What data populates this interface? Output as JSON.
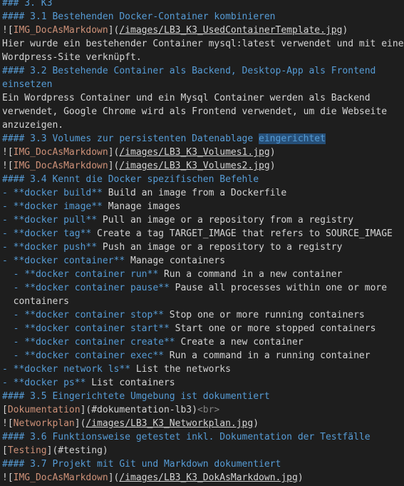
{
  "colors": {
    "background": "#1e1e1e",
    "text": "#d4d4d4",
    "heading": "#569cd6",
    "bracket": "#ce9178",
    "url": "#d4d4d4",
    "keyword": "#569cd6",
    "tag": "#808080",
    "selection": "#264f78"
  },
  "lines": [
    {
      "spans": [
        {
          "t": "### 3. K3",
          "c": "heading"
        }
      ]
    },
    {
      "spans": [
        {
          "t": "#### 3.1 Bestehenden Docker-Container kombinieren",
          "c": "heading"
        }
      ]
    },
    {
      "spans": [
        {
          "t": "![",
          "c": "text"
        },
        {
          "t": "IMG_DocAsMarkdown",
          "c": "bracket"
        },
        {
          "t": "](",
          "c": "text"
        },
        {
          "t": "/images/LB3_K3_UsedContainerTemplate.jpg",
          "c": "url",
          "u": true
        },
        {
          "t": ")",
          "c": "text"
        }
      ]
    },
    {
      "spans": [
        {
          "t": "Hier wurde ein bestehender Container mysql:latest verwendet und mit einer",
          "c": "text"
        }
      ]
    },
    {
      "spans": [
        {
          "t": "Wordpress-Site verknüpft.",
          "c": "text"
        }
      ]
    },
    {
      "spans": [
        {
          "t": "#### 3.2 Bestehende Container als Backend, Desktop-App als Frontend",
          "c": "heading"
        }
      ]
    },
    {
      "spans": [
        {
          "t": "einsetzen",
          "c": "heading"
        }
      ]
    },
    {
      "spans": [
        {
          "t": "Ein Wordpress Container und ein Mysql Container werden als Backend",
          "c": "text"
        }
      ]
    },
    {
      "spans": [
        {
          "t": "verwendet, Google Chrome wird als Frontend verwendet, um die Webseite",
          "c": "text"
        }
      ]
    },
    {
      "spans": [
        {
          "t": "anzuzeigen.",
          "c": "text"
        }
      ]
    },
    {
      "spans": [
        {
          "t": "#### 3.3 Volumes zur persistenten Datenablage ",
          "c": "heading"
        },
        {
          "t": "eingerichtet",
          "c": "heading",
          "h": true
        }
      ]
    },
    {
      "spans": [
        {
          "t": "![",
          "c": "text"
        },
        {
          "t": "IMG_DocAsMarkdown",
          "c": "bracket"
        },
        {
          "t": "](",
          "c": "text"
        },
        {
          "t": "/images/LB3_K3_Volumes1.jpg",
          "c": "url",
          "u": true
        },
        {
          "t": ")",
          "c": "text"
        }
      ]
    },
    {
      "spans": [
        {
          "t": "![",
          "c": "text"
        },
        {
          "t": "IMG_DocAsMarkdown",
          "c": "bracket"
        },
        {
          "t": "](",
          "c": "text"
        },
        {
          "t": "/images/LB3_K3_Volumes2.jpg",
          "c": "url",
          "u": true
        },
        {
          "t": ")",
          "c": "text"
        }
      ]
    },
    {
      "spans": [
        {
          "t": "#### 3.4 Kennt die Docker spezifischen Befehle",
          "c": "heading"
        }
      ]
    },
    {
      "spans": [
        {
          "t": "- ",
          "c": "keyword"
        },
        {
          "t": "**docker build**",
          "c": "keyword"
        },
        {
          "t": " Build an image from a Dockerfile",
          "c": "text"
        }
      ]
    },
    {
      "spans": [
        {
          "t": "- ",
          "c": "keyword"
        },
        {
          "t": "**docker image**",
          "c": "keyword"
        },
        {
          "t": " Manage images",
          "c": "text"
        }
      ]
    },
    {
      "spans": [
        {
          "t": "- ",
          "c": "keyword"
        },
        {
          "t": "**docker pull**",
          "c": "keyword"
        },
        {
          "t": " Pull an image or a repository from a registry",
          "c": "text"
        }
      ]
    },
    {
      "spans": [
        {
          "t": "- ",
          "c": "keyword"
        },
        {
          "t": "**docker tag**",
          "c": "keyword"
        },
        {
          "t": " Create a tag TARGET_IMAGE that refers to SOURCE_IMAGE",
          "c": "text"
        }
      ]
    },
    {
      "spans": [
        {
          "t": "- ",
          "c": "keyword"
        },
        {
          "t": "**docker push**",
          "c": "keyword"
        },
        {
          "t": " Push an image or a repository to a registry",
          "c": "text"
        }
      ]
    },
    {
      "spans": [
        {
          "t": "- ",
          "c": "keyword"
        },
        {
          "t": "**docker container**",
          "c": "keyword"
        },
        {
          "t": " Manage containers",
          "c": "text"
        }
      ]
    },
    {
      "spans": [
        {
          "t": "  - ",
          "c": "keyword"
        },
        {
          "t": "**docker container run**",
          "c": "keyword"
        },
        {
          "t": " Run a command in a new container",
          "c": "text"
        }
      ]
    },
    {
      "spans": [
        {
          "t": "  - ",
          "c": "keyword"
        },
        {
          "t": "**docker container pause**",
          "c": "keyword"
        },
        {
          "t": " Pause all processes within one or more",
          "c": "text"
        }
      ]
    },
    {
      "spans": [
        {
          "t": "  containers",
          "c": "text"
        }
      ]
    },
    {
      "spans": [
        {
          "t": "  - ",
          "c": "keyword"
        },
        {
          "t": "**docker container stop**",
          "c": "keyword"
        },
        {
          "t": " Stop one or more running containers",
          "c": "text"
        }
      ]
    },
    {
      "spans": [
        {
          "t": "  - ",
          "c": "keyword"
        },
        {
          "t": "**docker container start**",
          "c": "keyword"
        },
        {
          "t": " Start one or more stopped containers",
          "c": "text"
        }
      ]
    },
    {
      "spans": [
        {
          "t": "  - ",
          "c": "keyword"
        },
        {
          "t": "**docker container create**",
          "c": "keyword"
        },
        {
          "t": " Create a new container",
          "c": "text"
        }
      ]
    },
    {
      "spans": [
        {
          "t": "  - ",
          "c": "keyword"
        },
        {
          "t": "**docker container exec**",
          "c": "keyword"
        },
        {
          "t": " Run a command in a running container",
          "c": "text"
        }
      ]
    },
    {
      "spans": [
        {
          "t": "- ",
          "c": "keyword"
        },
        {
          "t": "**docker network ls**",
          "c": "keyword"
        },
        {
          "t": " List the networks",
          "c": "text"
        }
      ]
    },
    {
      "spans": [
        {
          "t": "- ",
          "c": "keyword"
        },
        {
          "t": "**docker ps**",
          "c": "keyword"
        },
        {
          "t": " List containers",
          "c": "text"
        }
      ]
    },
    {
      "spans": [
        {
          "t": "#### 3.5 Eingerichtete Umgebung ist dokumentiert",
          "c": "heading"
        }
      ]
    },
    {
      "spans": [
        {
          "t": "[",
          "c": "text"
        },
        {
          "t": "Dokumentation",
          "c": "bracket"
        },
        {
          "t": "](",
          "c": "text"
        },
        {
          "t": "#dokumentation-lb3",
          "c": "url"
        },
        {
          "t": ")",
          "c": "text"
        },
        {
          "t": "<br>",
          "c": "tag"
        }
      ]
    },
    {
      "spans": [
        {
          "t": "![",
          "c": "text"
        },
        {
          "t": "Networkplan",
          "c": "bracket"
        },
        {
          "t": "](",
          "c": "text"
        },
        {
          "t": "/images/LB3_K3_Networkplan.jpg",
          "c": "url",
          "u": true
        },
        {
          "t": ")",
          "c": "text"
        }
      ]
    },
    {
      "spans": [
        {
          "t": "#### 3.6 Funktionsweise getestet inkl. Dokumentation der Testfälle",
          "c": "heading"
        }
      ]
    },
    {
      "spans": [
        {
          "t": "[",
          "c": "text"
        },
        {
          "t": "Testing",
          "c": "bracket"
        },
        {
          "t": "](",
          "c": "text"
        },
        {
          "t": "#testing",
          "c": "url"
        },
        {
          "t": ")",
          "c": "text"
        }
      ]
    },
    {
      "spans": [
        {
          "t": "#### 3.7 Projekt mit Git und Markdown dokumentiert",
          "c": "heading"
        }
      ]
    },
    {
      "spans": [
        {
          "t": "![",
          "c": "text"
        },
        {
          "t": "IMG_DocAsMarkdown",
          "c": "bracket"
        },
        {
          "t": "](",
          "c": "text"
        },
        {
          "t": "/images/LB3_K3_DokAsMarkdown.jpg",
          "c": "url",
          "u": true
        },
        {
          "t": ")",
          "c": "text"
        }
      ]
    }
  ]
}
